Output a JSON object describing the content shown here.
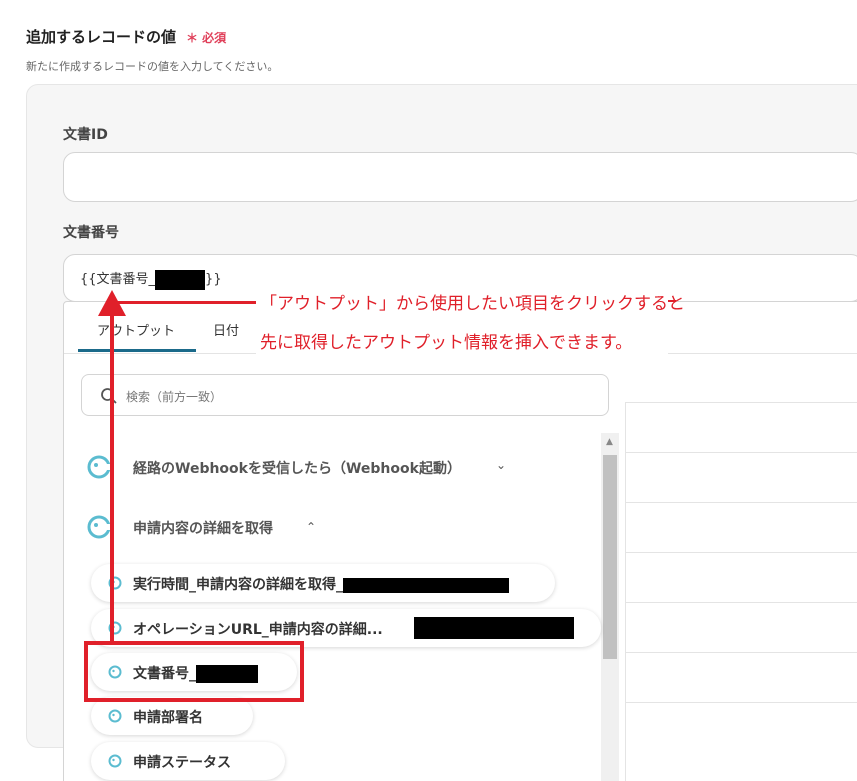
{
  "header": {
    "title": "追加するレコードの値",
    "required_mark": "＊ 必須",
    "description": "新たに作成するレコードの値を入力してください。"
  },
  "fields": {
    "doc_id": {
      "label": "文書ID",
      "value": ""
    },
    "doc_number": {
      "label": "文書番号",
      "value_prefix": "{{文書番号_",
      "value_suffix": "}}"
    }
  },
  "dropdown": {
    "tabs": [
      {
        "label": "アウトプット",
        "active": true
      },
      {
        "label": "日付",
        "active": false
      }
    ],
    "search_placeholder": "検索（前方一致）",
    "groups": [
      {
        "label": "経路のWebhookを受信したら（Webhook起動）",
        "expanded": false
      },
      {
        "label": "申請内容の詳細を取得",
        "expanded": true
      }
    ],
    "items": [
      {
        "label": "実行時間_申請内容の詳細を取得_"
      },
      {
        "label": "オペレーションURL_申請内容の詳細..."
      },
      {
        "label": "文書番号_"
      },
      {
        "label": "申請部署名"
      },
      {
        "label": "申請ステータス"
      }
    ]
  },
  "annotation": {
    "line1": "「アウトプット」から使用したい項目をクリックすると",
    "line2": "先に取得したアウトプット情報を挿入できます。",
    "color": "#e0202a"
  },
  "icons": {
    "search": "search-icon",
    "output_node": "output-node-icon",
    "chevron_down": "chevron-down-icon",
    "chevron_up": "chevron-up-icon"
  },
  "colors": {
    "accent_tab": "#1b6a8a",
    "required": "#e0405a",
    "node_icon": "#5bbcd0"
  }
}
